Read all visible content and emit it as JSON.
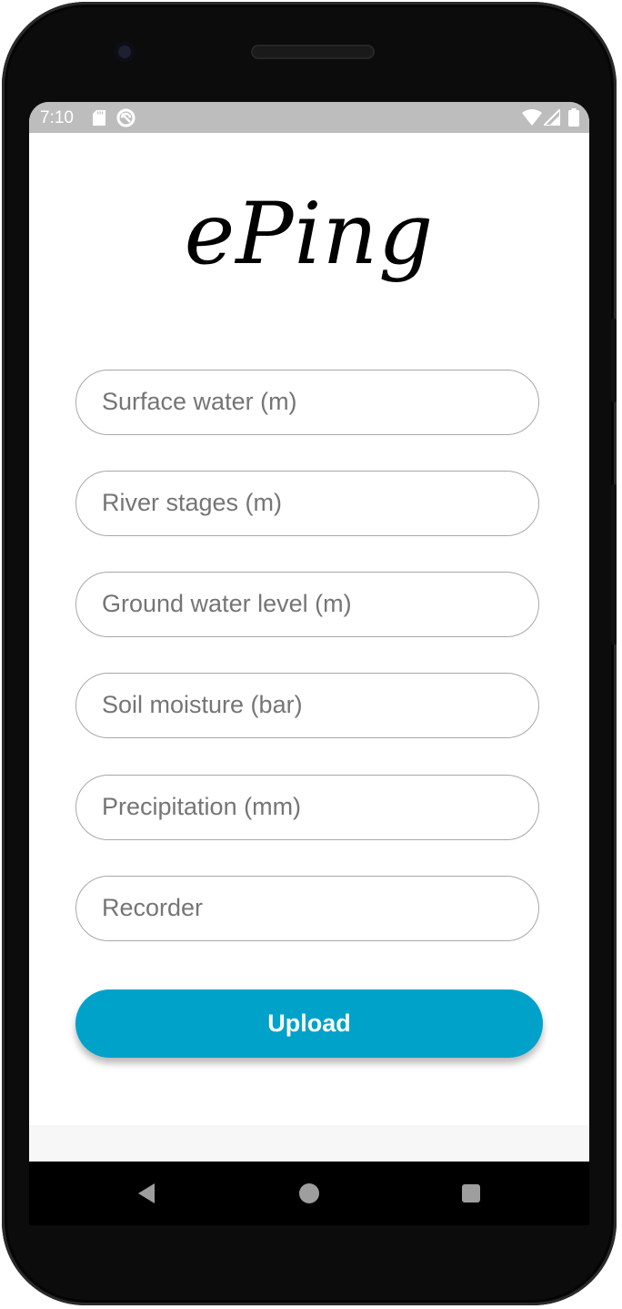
{
  "status_bar": {
    "time": "7:10",
    "icons": [
      "sd-card-icon",
      "sync-icon",
      "wifi-icon",
      "cell-signal-icon",
      "battery-icon"
    ]
  },
  "app": {
    "logo_text": "ePing"
  },
  "form": {
    "fields": [
      {
        "name": "surface-water",
        "placeholder": "Surface water (m)",
        "value": ""
      },
      {
        "name": "river-stages",
        "placeholder": "River stages (m)",
        "value": ""
      },
      {
        "name": "ground-water-level",
        "placeholder": "Ground water level (m)",
        "value": ""
      },
      {
        "name": "soil-moisture",
        "placeholder": "Soil moisture (bar)",
        "value": ""
      },
      {
        "name": "precipitation",
        "placeholder": "Precipitation (mm)",
        "value": ""
      },
      {
        "name": "recorder",
        "placeholder": "Recorder",
        "value": ""
      }
    ],
    "upload_label": "Upload"
  },
  "colors": {
    "accent": "#01a2c9",
    "status_bar": "#bdbdbd",
    "field_border": "#a8a8a8",
    "nav_icons": "#9e9e9e"
  },
  "nav_bar": {
    "icons": [
      "back-icon",
      "home-icon",
      "recents-icon"
    ]
  }
}
